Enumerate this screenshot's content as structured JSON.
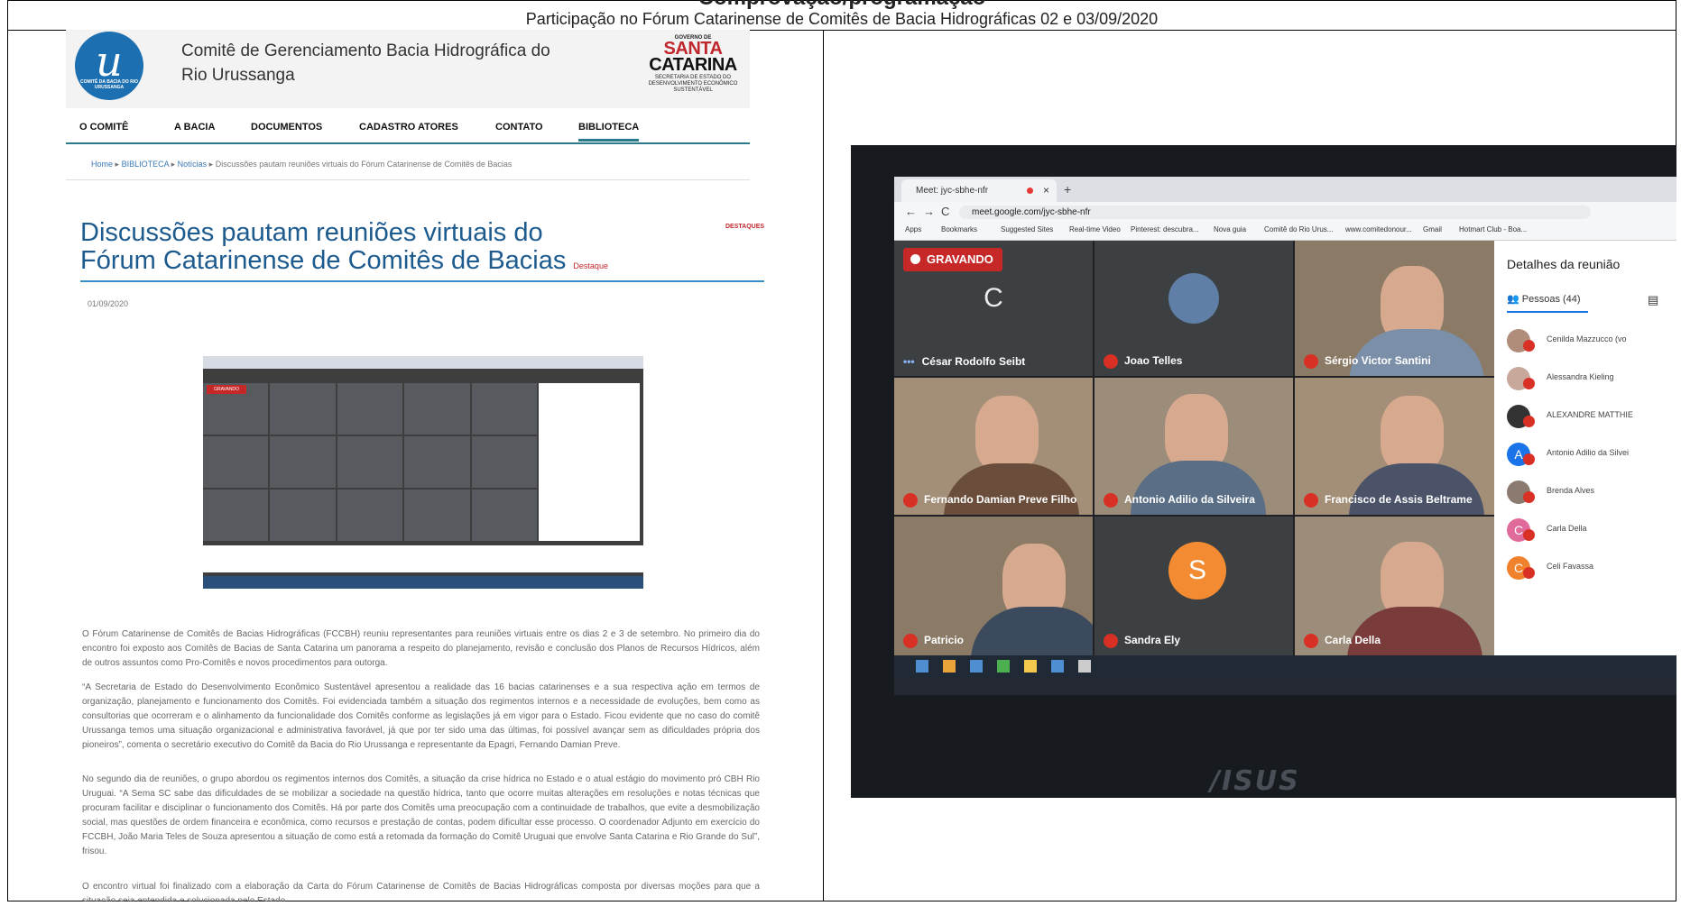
{
  "doc": {
    "heading": "Comprovação/programação",
    "caption": "Participação no Fórum Catarinense de Comitês de Bacia Hidrográficas 02 e 03/09/2020"
  },
  "site": {
    "logo_caption": "COMITÊ DA BACIA DO RIO URUSSANGA",
    "name": "Comitê de Gerenciamento Bacia Hidrográfica do Rio Urussanga",
    "gov_line1": "GOVERNO DE",
    "gov_line2": "SANTA",
    "gov_line3": "CATARINA",
    "gov_line4": "SECRETARIA DE ESTADO DO DESENVOLVIMENTO ECONÔMICO SUSTENTÁVEL",
    "nav": [
      "O COMITÊ",
      "A BACIA",
      "DOCUMENTOS",
      "CADASTRO ATORES",
      "CONTATO",
      "BIBLIOTECA"
    ],
    "breadcrumb": [
      "Home",
      "BIBLIOTECA",
      "Notícias",
      "Discussões pautam reuniões virtuais do Fórum Catarinense de Comitês de Bacias"
    ],
    "sidebar_tag": "DESTAQUES"
  },
  "article": {
    "title": "Discussões pautam reuniões virtuais do Fórum Catarinense de Comitês de Bacias",
    "tag": "Destaque",
    "date": "01/09/2020",
    "screenshot_rec": "GRAVANDO",
    "paragraphs": [
      "O Fórum Catarinense de Comitês de Bacias Hidrográficas (FCCBH) reuniu representantes para reuniões virtuais entre os dias 2 e 3 de setembro. No primeiro dia do encontro foi exposto aos Comitês de Bacias de Santa Catarina um panorama a respeito do planejamento, revisão e conclusão dos Planos de Recursos Hídricos, além de outros assuntos como Pro-Comitês e novos procedimentos para outorga.",
      "“A Secretaria de Estado do Desenvolvimento Econômico Sustentável apresentou a realidade das 16 bacias catarinenses e a sua respectiva ação em termos de organização, planejamento e funcionamento dos Comitês. Foi evidenciada também a situação dos regimentos internos e a necessidade de evoluções, bem como as consultorias que ocorreram e o alinhamento da funcionalidade dos Comitês conforme as legislações já em vigor para o Estado. Ficou evidente que no caso do comitê Urussanga temos uma situação organizacional e administrativa favorável, já que por ter sido uma das últimas, foi possível avançar sem as dificuldades própria dos pioneiros”, comenta o secretário executivo do Comitê da Bacia do Rio Urussanga e representante da Epagri, Fernando Damian Preve.",
      "No segundo dia de reuniões, o grupo abordou os regimentos internos dos Comitês, a situação da crise hídrica no Estado e o atual estágio do movimento pró CBH Rio Uruguai. “A Sema SC sabe das dificuldades de se mobilizar a sociedade na questão hídrica, tanto que ocorre muitas alterações em resoluções e notas técnicas que procuram facilitar e disciplinar o funcionamento dos Comitês. Há por parte dos Comitês uma preocupação com a continuidade de trabalhos, que evite a desmobilização social, mas questões de ordem financeira e econômica, como recursos e prestação de contas, podem dificultar esse processo. O coordenador Adjunto em exercício do FCCBH, João Maria Teles de Souza apresentou a situação de como está a retomada da formação do Comitê Uruguai que envolve Santa Catarina e Rio Grande do Sul”, frisou.",
      "O encontro virtual foi finalizado com a elaboração da Carta do Fórum Catarinense de Comitês de Bacias Hidrográficas composta por diversas moções para que a situação seja entendida e solucionada pelo Estado."
    ]
  },
  "photo": {
    "tab_title": "Meet: jyc-sbhe-nfr",
    "url": "meet.google.com/jyc-sbhe-nfr",
    "bookmarks": [
      "Apps",
      "Bookmarks",
      "Suggested Sites",
      "Real-time Video",
      "Pinterest: descubra...",
      "Nova guia",
      "Comitê do Rio Urus...",
      "www.comitedonour...",
      "Gmail",
      "Hotmart Club - Boa..."
    ],
    "recording": "GRAVANDO",
    "tiles": [
      {
        "name": "César Rodolfo Seibt",
        "initial": "C"
      },
      {
        "name": "Joao Telles"
      },
      {
        "name": "Sérgio Victor Santini"
      },
      {
        "name": "Fernando Damian Preve Filho"
      },
      {
        "name": "Antonio Adilio da Silveira"
      },
      {
        "name": "Francisco de Assis Beltrame"
      },
      {
        "name": "Patricio"
      },
      {
        "name": "Sandra Ely",
        "initial": "S"
      },
      {
        "name": "Carla Della"
      }
    ],
    "panel_title": "Detalhes da reunião",
    "people_tab": "Pessoas (44)",
    "people": [
      {
        "name": "Cenilda Mazzucco (vo",
        "initial": ""
      },
      {
        "name": "Alessandra Kieling",
        "initial": ""
      },
      {
        "name": "ALEXANDRE MATTHIE",
        "initial": ""
      },
      {
        "name": "Antonio Adilio da Silvei",
        "initial": "A"
      },
      {
        "name": "Brenda Alves",
        "initial": ""
      },
      {
        "name": "Carla Della",
        "initial": "C"
      },
      {
        "name": "Celi Favassa",
        "initial": "C"
      }
    ],
    "laptop_brand": "/ISUS"
  }
}
